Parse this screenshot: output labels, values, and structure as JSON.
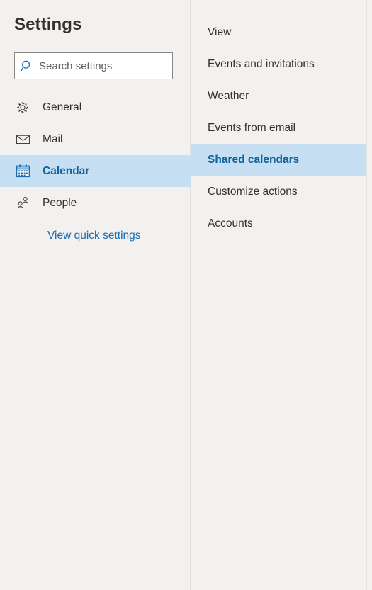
{
  "app": {
    "title": "Settings",
    "accent_blue": "#1b6cb3",
    "selected_bg": "#c7dff2",
    "selected_text": "#11659c",
    "background": "#f2f1ef",
    "annotation_color": "#1f3a73"
  },
  "search": {
    "placeholder": "Search settings",
    "value": "",
    "icon": "search-icon"
  },
  "sidebar": {
    "items": [
      {
        "label": "General",
        "icon": "gear-icon",
        "selected": false
      },
      {
        "label": "Mail",
        "icon": "envelope-icon",
        "selected": false
      },
      {
        "label": "Calendar",
        "icon": "calendar-icon",
        "selected": true
      },
      {
        "label": "People",
        "icon": "people-icon",
        "selected": false
      }
    ],
    "quick_settings_link": "View quick settings"
  },
  "submenu": {
    "items": [
      {
        "label": "View",
        "selected": false
      },
      {
        "label": "Events and invitations",
        "selected": false
      },
      {
        "label": "Weather",
        "selected": false
      },
      {
        "label": "Events from email",
        "selected": false
      },
      {
        "label": "Shared calendars",
        "selected": true
      },
      {
        "label": "Customize actions",
        "selected": false
      },
      {
        "label": "Accounts",
        "selected": false
      }
    ]
  },
  "annotation": {
    "type": "arrow",
    "direction": "up",
    "points_to": "Shared calendars",
    "color": "#1f3a73"
  }
}
